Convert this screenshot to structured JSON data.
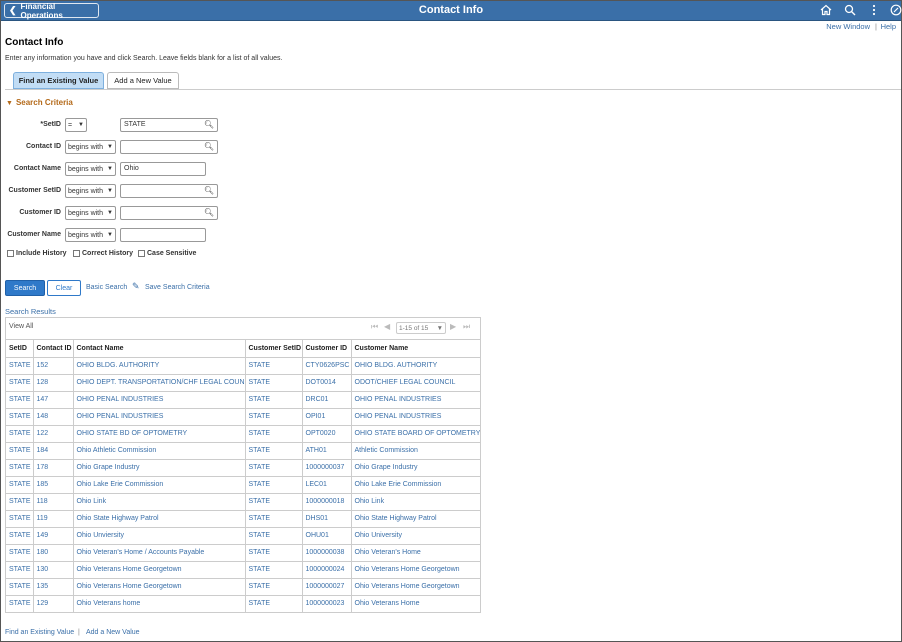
{
  "header": {
    "back_label": "Financial Operations",
    "title": "Contact Info",
    "icons": [
      "home-icon",
      "search-icon",
      "more-menu-icon",
      "navbar-icon"
    ]
  },
  "links": {
    "new_window": "New Window",
    "separator": "|",
    "help": "Help"
  },
  "page": {
    "title": "Contact Info",
    "instructions": "Enter any information you have and click Search. Leave fields blank for a list of all values."
  },
  "tabs": {
    "find": "Find an Existing Value",
    "add": "Add a New Value"
  },
  "search_criteria": {
    "header": "Search Criteria",
    "fields": [
      {
        "label": "SetID",
        "required_mark": "*",
        "operator": "=",
        "value": "STATE"
      },
      {
        "label": "Contact ID",
        "operator": "begins with",
        "value": ""
      },
      {
        "label": "Contact Name",
        "operator": "begins with",
        "value": "Ohio"
      },
      {
        "label": "Customer SetID",
        "operator": "begins with",
        "value": ""
      },
      {
        "label": "Customer ID",
        "operator": "begins with",
        "value": ""
      },
      {
        "label": "Customer Name",
        "operator": "begins with",
        "value": ""
      }
    ],
    "checkboxes": [
      "Include History",
      "Correct History",
      "Case Sensitive"
    ]
  },
  "actions": {
    "search": "Search",
    "clear": "Clear",
    "basic_search": "Basic Search",
    "save_search": "Save Search Criteria"
  },
  "results": {
    "title": "Search Results",
    "view_all": "View All",
    "page_count": "1-15 of 15",
    "columns": [
      "SetID",
      "Contact ID",
      "Contact Name",
      "Customer SetID",
      "Customer ID",
      "Customer Name"
    ],
    "rows": [
      [
        "STATE",
        "152",
        "OHIO BLDG. AUTHORITY",
        "STATE",
        "CTY0626PSC",
        "OHIO BLDG. AUTHORITY"
      ],
      [
        "STATE",
        "128",
        "OHIO DEPT. TRANSPORTATION/CHF LEGAL COUN",
        "STATE",
        "DOT0014",
        "ODOT/CHIEF LEGAL COUNCIL"
      ],
      [
        "STATE",
        "147",
        "OHIO PENAL INDUSTRIES",
        "STATE",
        "DRC01",
        "OHIO PENAL INDUSTRIES"
      ],
      [
        "STATE",
        "148",
        "OHIO PENAL INDUSTRIES",
        "STATE",
        "OPI01",
        "OHIO PENAL INDUSTRIES"
      ],
      [
        "STATE",
        "122",
        "OHIO STATE BD OF OPTOMETRY",
        "STATE",
        "OPT0020",
        "OHIO STATE BOARD OF OPTOMETRY"
      ],
      [
        "STATE",
        "184",
        "Ohio Athletic Commission",
        "STATE",
        "ATH01",
        "Athletic Commission"
      ],
      [
        "STATE",
        "178",
        "Ohio Grape Industry",
        "STATE",
        "1000000037",
        "Ohio Grape Industry"
      ],
      [
        "STATE",
        "185",
        "Ohio Lake Erie Commission",
        "STATE",
        "LEC01",
        "Ohio Lake Erie Commission"
      ],
      [
        "STATE",
        "118",
        "Ohio Link",
        "STATE",
        "1000000018",
        "Ohio Link"
      ],
      [
        "STATE",
        "119",
        "Ohio State Highway Patrol",
        "STATE",
        "DHS01",
        "Ohio State Highway Patrol"
      ],
      [
        "STATE",
        "149",
        "Ohio Unviersity",
        "STATE",
        "OHU01",
        "Ohio University"
      ],
      [
        "STATE",
        "180",
        "Ohio Veteran's Home / Accounts Payable",
        "STATE",
        "1000000038",
        "Ohio Veteran's Home"
      ],
      [
        "STATE",
        "130",
        "Ohio Veterans Home Georgetown",
        "STATE",
        "1000000024",
        "Ohio Veterans Home Georgetown"
      ],
      [
        "STATE",
        "135",
        "Ohio Veterans Home Georgetown",
        "STATE",
        "1000000027",
        "Ohio Veterans Home Georgetown"
      ],
      [
        "STATE",
        "129",
        "Ohio Veterans home",
        "STATE",
        "1000000023",
        "Ohio Veterans Home"
      ]
    ]
  },
  "footer": {
    "find": "Find an Existing Value",
    "separator": "|",
    "add": "Add a New Value"
  },
  "colors": {
    "header_bg": "#3a6fa8",
    "link": "#3a6fa8",
    "primary_button": "#2f79c9",
    "section_header": "#b46a1a"
  }
}
